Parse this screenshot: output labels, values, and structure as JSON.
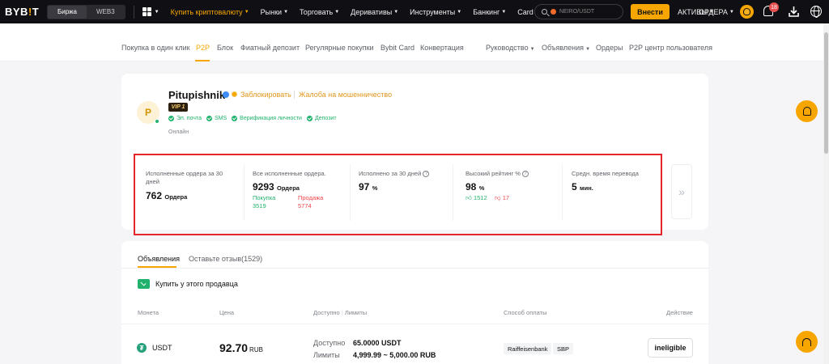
{
  "topnav": {
    "logo_a": "BYB",
    "logo_b": "!",
    "logo_c": "T",
    "seg_exchange": "Биржа",
    "seg_web3": "WEB3",
    "items": [
      "Купить криптовалюту",
      "Рынки",
      "Торговать",
      "Деривативы",
      "Инструменты",
      "Банкинг",
      "Card"
    ],
    "search_placeholder": "NEIRO/USDT",
    "deposit": "Внести",
    "assets": "АКТИВЫ",
    "orders": "ОРДЕРА",
    "notif_count": "18"
  },
  "subnav": {
    "items": [
      "Покупка в один клик",
      "P2P",
      "Блок",
      "Фиатный депозит",
      "Регулярные покупки",
      "Bybit Card",
      "Конвертация"
    ],
    "right": [
      "Руководство",
      "Объявления",
      "Ордеры",
      "P2P центр пользователя"
    ]
  },
  "profile": {
    "initial": "P",
    "name": "Pitupishnik",
    "block": "Заблокировать",
    "report": "Жалоба на мошенничество",
    "vip": "VIP 1",
    "verifications": [
      "Эл. почта",
      "SMS",
      "Верификация личности",
      "Депозит"
    ],
    "status": "Онлайн"
  },
  "stats": {
    "s1_label": "Исполненные ордера за 30 дней",
    "s1_value": "762",
    "s1_unit": "Ордера",
    "s2_label": "Все исполненные ордера.",
    "s2_value": "9293",
    "s2_unit": "Ордера",
    "buy_label": "Покупка",
    "buy_value": "3519",
    "sell_label": "Продажа",
    "sell_value": "5774",
    "s3_label": "Исполнено за 30 дней",
    "s3_value": "97",
    "s3_unit": "%",
    "s4_label": "Высокий рейтинг %",
    "s4_value": "98",
    "s4_unit": "%",
    "likes": "1512",
    "dislikes": "17",
    "s5_label": "Средн. время перевода",
    "s5_value": "5",
    "s5_unit": "мин."
  },
  "tabs": {
    "ads": "Объявления",
    "reviews": "Оставьте отзыв(1529)"
  },
  "buy_from": "Купить у этого продавца",
  "table": {
    "headers": [
      "Монета",
      "Цена",
      "Доступно",
      "Лимиты",
      "Способ оплаты",
      "Действие"
    ],
    "row": {
      "coin": "USDT",
      "price": "92.70",
      "currency": "RUB",
      "avail_label": "Доступно",
      "limit_label": "Лимиты",
      "avail_value": "65.0000 USDT",
      "limit_value": "4,999.99 ~ 5,000.00 RUB",
      "payments": [
        "Raiffeisenbank",
        "SBP"
      ],
      "action": "ineligible"
    }
  },
  "colors": {
    "accent": "#f7a600",
    "green": "#20b26c",
    "red": "#ef454a",
    "highlight_box": "#e5252a"
  }
}
